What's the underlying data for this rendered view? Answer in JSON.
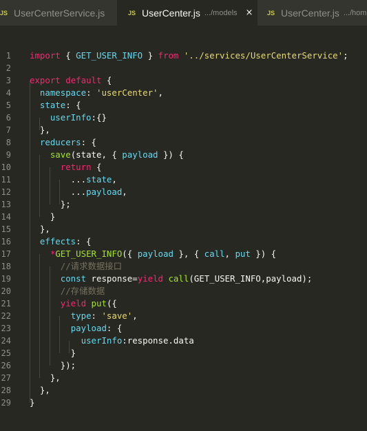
{
  "tabs": [
    {
      "icon": "JS",
      "name": "UserCenterService.js",
      "desc": "",
      "active": false
    },
    {
      "icon": "JS",
      "name": "UserCenter.js",
      "desc": ".../models",
      "active": true,
      "close": "×"
    },
    {
      "icon": "JS",
      "name": "UserCenter.js",
      "desc": ".../hom",
      "active": false
    }
  ],
  "editor": {
    "lines": [
      {
        "n": "1",
        "t": [
          [
            "k",
            "import"
          ],
          [
            "w",
            " { "
          ],
          [
            "v",
            "GET_USER_INFO"
          ],
          [
            "w",
            " } "
          ],
          [
            "k",
            "from"
          ],
          [
            "w",
            " "
          ],
          [
            "s",
            "'../services/UserCenterService'"
          ],
          [
            "w",
            ";"
          ]
        ]
      },
      {
        "n": "2",
        "t": []
      },
      {
        "n": "3",
        "t": [
          [
            "k",
            "export"
          ],
          [
            "w",
            " "
          ],
          [
            "k",
            "default"
          ],
          [
            "w",
            " {"
          ]
        ]
      },
      {
        "n": "4",
        "t": [
          [
            "w",
            "  "
          ],
          [
            "v",
            "namespace"
          ],
          [
            "w",
            ": "
          ],
          [
            "s",
            "'userCenter'"
          ],
          [
            "w",
            ","
          ]
        ]
      },
      {
        "n": "5",
        "t": [
          [
            "w",
            "  "
          ],
          [
            "v",
            "state"
          ],
          [
            "w",
            ": {"
          ]
        ]
      },
      {
        "n": "6",
        "t": [
          [
            "w",
            "    "
          ],
          [
            "v",
            "userInfo"
          ],
          [
            "w",
            ":{}"
          ]
        ]
      },
      {
        "n": "7",
        "t": [
          [
            "w",
            "  },"
          ]
        ]
      },
      {
        "n": "8",
        "t": [
          [
            "w",
            "  "
          ],
          [
            "v",
            "reducers"
          ],
          [
            "w",
            ": {"
          ]
        ]
      },
      {
        "n": "9",
        "t": [
          [
            "w",
            "    "
          ],
          [
            "f",
            "save"
          ],
          [
            "w",
            "(state, { "
          ],
          [
            "v",
            "payload"
          ],
          [
            "w",
            " }) {"
          ]
        ]
      },
      {
        "n": "10",
        "t": [
          [
            "w",
            "      "
          ],
          [
            "k",
            "return"
          ],
          [
            "w",
            " {"
          ]
        ]
      },
      {
        "n": "11",
        "t": [
          [
            "w",
            "        ..."
          ],
          [
            "v",
            "state"
          ],
          [
            "w",
            ","
          ]
        ]
      },
      {
        "n": "12",
        "t": [
          [
            "w",
            "        ..."
          ],
          [
            "v",
            "payload"
          ],
          [
            "w",
            ","
          ]
        ]
      },
      {
        "n": "13",
        "t": [
          [
            "w",
            "      };"
          ]
        ]
      },
      {
        "n": "14",
        "t": [
          [
            "w",
            "    }"
          ]
        ]
      },
      {
        "n": "15",
        "t": [
          [
            "w",
            "  },"
          ]
        ]
      },
      {
        "n": "16",
        "t": [
          [
            "w",
            "  "
          ],
          [
            "v",
            "effects"
          ],
          [
            "w",
            ": {"
          ]
        ]
      },
      {
        "n": "17",
        "t": [
          [
            "w",
            "    "
          ],
          [
            "k",
            "*"
          ],
          [
            "f",
            "GET_USER_INFO"
          ],
          [
            "w",
            "({ "
          ],
          [
            "v",
            "payload"
          ],
          [
            "w",
            " }, { "
          ],
          [
            "v",
            "call"
          ],
          [
            "w",
            ", "
          ],
          [
            "v",
            "put"
          ],
          [
            "w",
            " }) {"
          ]
        ]
      },
      {
        "n": "18",
        "t": [
          [
            "w",
            "      "
          ],
          [
            "c",
            "//请求数据接口"
          ]
        ]
      },
      {
        "n": "19",
        "t": [
          [
            "w",
            "      "
          ],
          [
            "v",
            "const"
          ],
          [
            "w",
            " response="
          ],
          [
            "k",
            "yield"
          ],
          [
            "w",
            " "
          ],
          [
            "f",
            "call"
          ],
          [
            "w",
            "(GET_USER_INFO,payload);"
          ]
        ]
      },
      {
        "n": "20",
        "t": [
          [
            "w",
            "      "
          ],
          [
            "c",
            "//存储数据"
          ]
        ]
      },
      {
        "n": "21",
        "t": [
          [
            "w",
            "      "
          ],
          [
            "k",
            "yield"
          ],
          [
            "w",
            " "
          ],
          [
            "f",
            "put"
          ],
          [
            "w",
            "({"
          ]
        ]
      },
      {
        "n": "22",
        "t": [
          [
            "w",
            "        "
          ],
          [
            "v",
            "type"
          ],
          [
            "w",
            ": "
          ],
          [
            "s",
            "'save'"
          ],
          [
            "w",
            ","
          ]
        ]
      },
      {
        "n": "23",
        "t": [
          [
            "w",
            "        "
          ],
          [
            "v",
            "payload"
          ],
          [
            "w",
            ": {"
          ]
        ]
      },
      {
        "n": "24",
        "t": [
          [
            "w",
            "          "
          ],
          [
            "v",
            "userInfo"
          ],
          [
            "w",
            ":response.data"
          ]
        ]
      },
      {
        "n": "25",
        "t": [
          [
            "w",
            "        }"
          ]
        ]
      },
      {
        "n": "26",
        "t": [
          [
            "w",
            "      });"
          ]
        ]
      },
      {
        "n": "27",
        "t": [
          [
            "w",
            "    },"
          ]
        ]
      },
      {
        "n": "28",
        "t": [
          [
            "w",
            "  },"
          ]
        ]
      },
      {
        "n": "29",
        "t": [
          [
            "w",
            "}"
          ]
        ]
      }
    ]
  },
  "colors": {
    "background": "#272822",
    "keyword": "#f92672",
    "string": "#e6db74",
    "function": "#a6e22e",
    "identifier": "#66d9ef",
    "comment": "#75715e",
    "js_icon": "#cbcb41"
  }
}
